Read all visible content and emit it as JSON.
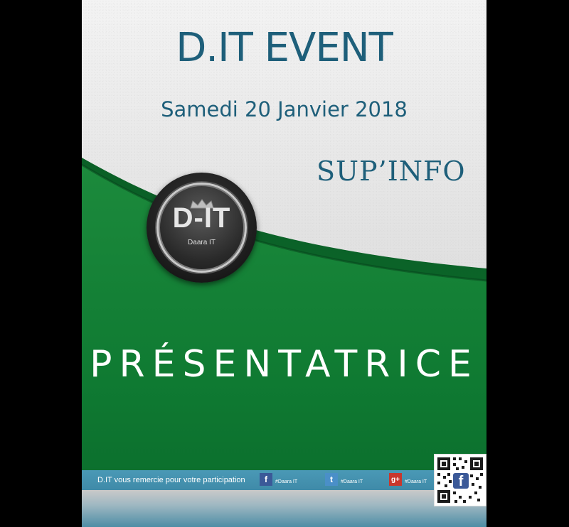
{
  "event": {
    "title": "D.IT EVENT",
    "date": "Samedi 20 Janvier 2018",
    "venue": "SUP’INFO",
    "role": "PRÉSENTATRICE"
  },
  "logo": {
    "text": "D-IT",
    "subtitle": "Daara IT"
  },
  "footer": {
    "thanks": "D.IT vous remercie pour votre participation",
    "social": [
      {
        "icon": "facebook-icon",
        "glyph": "f",
        "tag": "#Daara IT",
        "color": "#3b5998"
      },
      {
        "icon": "twitter-icon",
        "glyph": "t",
        "tag": "#Daara IT",
        "color": "#4a8fc8"
      },
      {
        "icon": "google-plus-icon",
        "glyph": "g+",
        "tag": "#Daara IT",
        "color": "#c8372d"
      }
    ]
  },
  "colors": {
    "title": "#1e5f7a",
    "green": "#0f7a34",
    "footer": "#4a99b6"
  }
}
